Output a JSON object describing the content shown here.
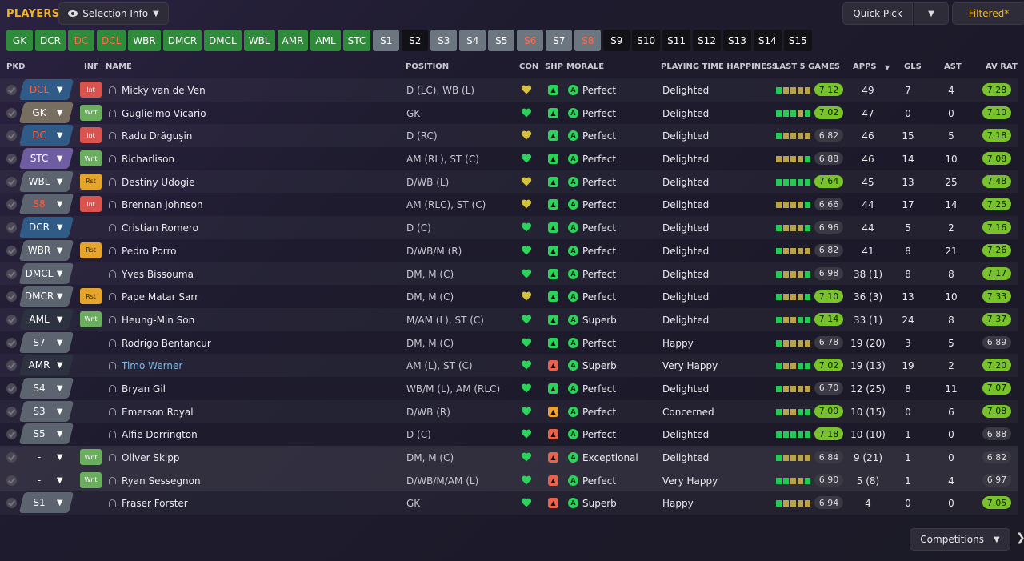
{
  "header": {
    "title": "PLAYERS",
    "selection_info": "Selection Info",
    "quick_pick": "Quick Pick",
    "filtered": "Filtered*"
  },
  "position_chips": [
    {
      "label": "GK",
      "style": "green"
    },
    {
      "label": "DCR",
      "style": "green"
    },
    {
      "label": "DC",
      "style": "green-red"
    },
    {
      "label": "DCL",
      "style": "green-red"
    },
    {
      "label": "WBR",
      "style": "green"
    },
    {
      "label": "DMCR",
      "style": "green"
    },
    {
      "label": "DMCL",
      "style": "green"
    },
    {
      "label": "WBL",
      "style": "green"
    },
    {
      "label": "AMR",
      "style": "green"
    },
    {
      "label": "AML",
      "style": "green"
    },
    {
      "label": "STC",
      "style": "green"
    },
    {
      "label": "S1",
      "style": "grey"
    },
    {
      "label": "S2",
      "style": "black"
    },
    {
      "label": "S3",
      "style": "grey"
    },
    {
      "label": "S4",
      "style": "grey"
    },
    {
      "label": "S5",
      "style": "grey"
    },
    {
      "label": "S6",
      "style": "grey-red"
    },
    {
      "label": "S7",
      "style": "grey"
    },
    {
      "label": "S8",
      "style": "grey-red"
    },
    {
      "label": "S9",
      "style": "black"
    },
    {
      "label": "S10",
      "style": "black"
    },
    {
      "label": "S11",
      "style": "black"
    },
    {
      "label": "S12",
      "style": "black"
    },
    {
      "label": "S13",
      "style": "black"
    },
    {
      "label": "S14",
      "style": "black"
    },
    {
      "label": "S15",
      "style": "black"
    }
  ],
  "columns": {
    "pkd": "PKD",
    "inf": "INF",
    "name": "NAME",
    "position": "POSITION",
    "con": "CON",
    "shp": "SHP",
    "morale": "MORALE",
    "pth": "PLAYING TIME HAPPINESS",
    "last5": "LAST 5 GAMES",
    "apps": "APPS",
    "gls": "GLS",
    "ast": "AST",
    "avrat": "AV RAT"
  },
  "colors": {
    "accent": "#f0b429",
    "positive": "#79c32a",
    "injury": "#d9534f",
    "wanted": "#6cae60",
    "rest": "#e5a52a"
  },
  "players": [
    {
      "pkd": "DCL",
      "pkd_style": "blue",
      "inf": "Int",
      "name": "Micky van de Ven",
      "position": "D (LC), WB (L)",
      "con": "yellow",
      "shp": "g",
      "morale": "Perfect",
      "pth": "Delighted",
      "form": [
        "g",
        "y",
        "y",
        "y",
        "y"
      ],
      "last5": "7.12",
      "last5_hi": true,
      "apps": "49",
      "gls": "7",
      "ast": "4",
      "avrat": "7.28",
      "avrat_hi": true
    },
    {
      "pkd": "GK",
      "pkd_style": "brown",
      "inf": "Wnt",
      "name": "Guglielmo Vicario",
      "position": "GK",
      "con": "green",
      "shp": "g",
      "morale": "Perfect",
      "pth": "Delighted",
      "form": [
        "g",
        "g",
        "g",
        "y",
        "g"
      ],
      "last5": "7.02",
      "last5_hi": true,
      "apps": "47",
      "gls": "0",
      "ast": "0",
      "avrat": "7.10",
      "avrat_hi": true
    },
    {
      "pkd": "DC",
      "pkd_style": "blue",
      "inf": "Int",
      "name": "Radu Drăgușin",
      "position": "D (RC)",
      "con": "yellow",
      "shp": "g",
      "morale": "Perfect",
      "pth": "Delighted",
      "form": [
        "g",
        "y",
        "y",
        "y",
        "y"
      ],
      "last5": "6.82",
      "last5_hi": false,
      "apps": "46",
      "gls": "15",
      "ast": "5",
      "avrat": "7.18",
      "avrat_hi": true
    },
    {
      "pkd": "STC",
      "pkd_style": "purple",
      "inf": "Wnt",
      "name": "Richarlison",
      "position": "AM (RL), ST (C)",
      "con": "green",
      "shp": "g",
      "morale": "Perfect",
      "pth": "Delighted",
      "form": [
        "y",
        "y",
        "y",
        "y",
        "g"
      ],
      "last5": "6.88",
      "last5_hi": false,
      "apps": "46",
      "gls": "14",
      "ast": "10",
      "avrat": "7.08",
      "avrat_hi": true
    },
    {
      "pkd": "WBL",
      "pkd_style": "grey",
      "inf": "Rst",
      "name": "Destiny Udogie",
      "position": "D/WB (L)",
      "con": "yellow",
      "shp": "g",
      "morale": "Perfect",
      "pth": "Delighted",
      "form": [
        "g",
        "g",
        "g",
        "g",
        "g"
      ],
      "last5": "7.64",
      "last5_hi": true,
      "apps": "45",
      "gls": "13",
      "ast": "25",
      "avrat": "7.48",
      "avrat_hi": true
    },
    {
      "pkd": "S8",
      "pkd_style": "grey-red",
      "inf": "Int",
      "name": "Brennan Johnson",
      "position": "AM (RLC), ST (C)",
      "con": "yellow",
      "shp": "g",
      "morale": "Perfect",
      "pth": "Delighted",
      "form": [
        "y",
        "y",
        "y",
        "y",
        "g"
      ],
      "last5": "6.66",
      "last5_hi": false,
      "apps": "44",
      "gls": "17",
      "ast": "14",
      "avrat": "7.25",
      "avrat_hi": true
    },
    {
      "pkd": "DCR",
      "pkd_style": "blueW",
      "inf": "",
      "name": "Cristian Romero",
      "position": "D (C)",
      "con": "green",
      "shp": "g",
      "morale": "Perfect",
      "pth": "Delighted",
      "form": [
        "g",
        "y",
        "y",
        "y",
        "g"
      ],
      "last5": "6.96",
      "last5_hi": false,
      "apps": "44",
      "gls": "5",
      "ast": "2",
      "avrat": "7.16",
      "avrat_hi": true
    },
    {
      "pkd": "WBR",
      "pkd_style": "grey",
      "inf": "Rst",
      "name": "Pedro Porro",
      "position": "D/WB/M (R)",
      "con": "green",
      "shp": "g",
      "morale": "Perfect",
      "pth": "Delighted",
      "form": [
        "g",
        "y",
        "y",
        "y",
        "y"
      ],
      "last5": "6.82",
      "last5_hi": false,
      "apps": "41",
      "gls": "8",
      "ast": "21",
      "avrat": "7.26",
      "avrat_hi": true
    },
    {
      "pkd": "DMCL",
      "pkd_style": "grey",
      "inf": "",
      "name": "Yves Bissouma",
      "position": "DM, M (C)",
      "con": "green",
      "shp": "g",
      "morale": "Perfect",
      "pth": "Delighted",
      "form": [
        "g",
        "y",
        "y",
        "y",
        "g"
      ],
      "last5": "6.98",
      "last5_hi": false,
      "apps": "38 (1)",
      "gls": "8",
      "ast": "8",
      "avrat": "7.17",
      "avrat_hi": true
    },
    {
      "pkd": "DMCR",
      "pkd_style": "grey",
      "inf": "Rst",
      "name": "Pape Matar Sarr",
      "position": "DM, M (C)",
      "con": "yellow",
      "shp": "g",
      "morale": "Perfect",
      "pth": "Delighted",
      "form": [
        "g",
        "y",
        "y",
        "y",
        "g"
      ],
      "last5": "7.10",
      "last5_hi": true,
      "apps": "36 (3)",
      "gls": "13",
      "ast": "10",
      "avrat": "7.33",
      "avrat_hi": true
    },
    {
      "pkd": "AML",
      "pkd_style": "dark",
      "inf": "Wnt",
      "name": "Heung-Min Son",
      "position": "M/AM (L), ST (C)",
      "con": "green",
      "shp": "g",
      "morale": "Superb",
      "pth": "Delighted",
      "form": [
        "g",
        "y",
        "y",
        "g",
        "g"
      ],
      "last5": "7.14",
      "last5_hi": true,
      "apps": "33 (1)",
      "gls": "24",
      "ast": "8",
      "avrat": "7.37",
      "avrat_hi": true
    },
    {
      "pkd": "S7",
      "pkd_style": "grey",
      "inf": "",
      "name": "Rodrigo Bentancur",
      "position": "DM, M (C)",
      "con": "green",
      "shp": "g",
      "morale": "Perfect",
      "pth": "Happy",
      "form": [
        "g",
        "y",
        "y",
        "y",
        "y"
      ],
      "last5": "6.78",
      "last5_hi": false,
      "apps": "19 (20)",
      "gls": "3",
      "ast": "5",
      "avrat": "6.89",
      "avrat_hi": false
    },
    {
      "pkd": "AMR",
      "pkd_style": "dark",
      "inf": "",
      "name": "Timo Werner",
      "name_link": true,
      "position": "AM (L), ST (C)",
      "con": "green",
      "shp": "r",
      "morale": "Superb",
      "pth": "Very Happy",
      "form": [
        "g",
        "y",
        "y",
        "g",
        "g"
      ],
      "last5": "7.02",
      "last5_hi": true,
      "apps": "19 (13)",
      "gls": "19",
      "ast": "2",
      "avrat": "7.20",
      "avrat_hi": true
    },
    {
      "pkd": "S4",
      "pkd_style": "grey",
      "inf": "",
      "name": "Bryan Gil",
      "position": "WB/M (L), AM (RLC)",
      "con": "green",
      "shp": "g",
      "morale": "Perfect",
      "pth": "Delighted",
      "form": [
        "g",
        "y",
        "y",
        "y",
        "y"
      ],
      "last5": "6.70",
      "last5_hi": false,
      "apps": "12 (25)",
      "gls": "8",
      "ast": "11",
      "avrat": "7.07",
      "avrat_hi": true
    },
    {
      "pkd": "S3",
      "pkd_style": "grey",
      "inf": "",
      "name": "Emerson Royal",
      "position": "D/WB (R)",
      "con": "green",
      "shp": "o",
      "morale": "Perfect",
      "pth": "Concerned",
      "form": [
        "g",
        "y",
        "y",
        "g",
        "g"
      ],
      "last5": "7.00",
      "last5_hi": true,
      "apps": "10 (15)",
      "gls": "0",
      "ast": "6",
      "avrat": "7.08",
      "avrat_hi": true
    },
    {
      "pkd": "S5",
      "pkd_style": "grey",
      "inf": "",
      "name": "Alfie Dorrington",
      "position": "D (C)",
      "con": "green",
      "shp": "r",
      "morale": "Perfect",
      "pth": "Delighted",
      "form": [
        "g",
        "g",
        "g",
        "g",
        "g"
      ],
      "last5": "7.18",
      "last5_hi": true,
      "apps": "10 (10)",
      "gls": "1",
      "ast": "0",
      "avrat": "6.88",
      "avrat_hi": false
    },
    {
      "pkd": "-",
      "pkd_style": "none",
      "inf": "Wnt",
      "name": "Oliver Skipp",
      "position": "DM, M (C)",
      "con": "green",
      "shp": "r",
      "morale": "Exceptional",
      "pth": "Delighted",
      "form": [
        "g",
        "y",
        "y",
        "y",
        "y"
      ],
      "last5": "6.84",
      "last5_hi": false,
      "apps": "9 (21)",
      "gls": "1",
      "ast": "0",
      "avrat": "6.82",
      "avrat_hi": false,
      "highlight": true
    },
    {
      "pkd": "-",
      "pkd_style": "none",
      "inf": "Wnt",
      "name": "Ryan Sessegnon",
      "position": "D/WB/M/AM (L)",
      "con": "green",
      "shp": "r",
      "morale": "Perfect",
      "pth": "Very Happy",
      "form": [
        "g",
        "g",
        "y",
        "y",
        "g"
      ],
      "last5": "6.90",
      "last5_hi": false,
      "apps": "5 (8)",
      "gls": "1",
      "ast": "4",
      "avrat": "6.97",
      "avrat_hi": false,
      "highlight": true
    },
    {
      "pkd": "S1",
      "pkd_style": "grey",
      "inf": "",
      "name": "Fraser Forster",
      "position": "GK",
      "con": "green",
      "shp": "r",
      "morale": "Superb",
      "pth": "Happy",
      "form": [
        "g",
        "y",
        "y",
        "y",
        "y"
      ],
      "last5": "6.94",
      "last5_hi": false,
      "apps": "4",
      "gls": "0",
      "ast": "0",
      "avrat": "7.05",
      "avrat_hi": true
    }
  ],
  "footer": {
    "competitions": "Competitions"
  }
}
